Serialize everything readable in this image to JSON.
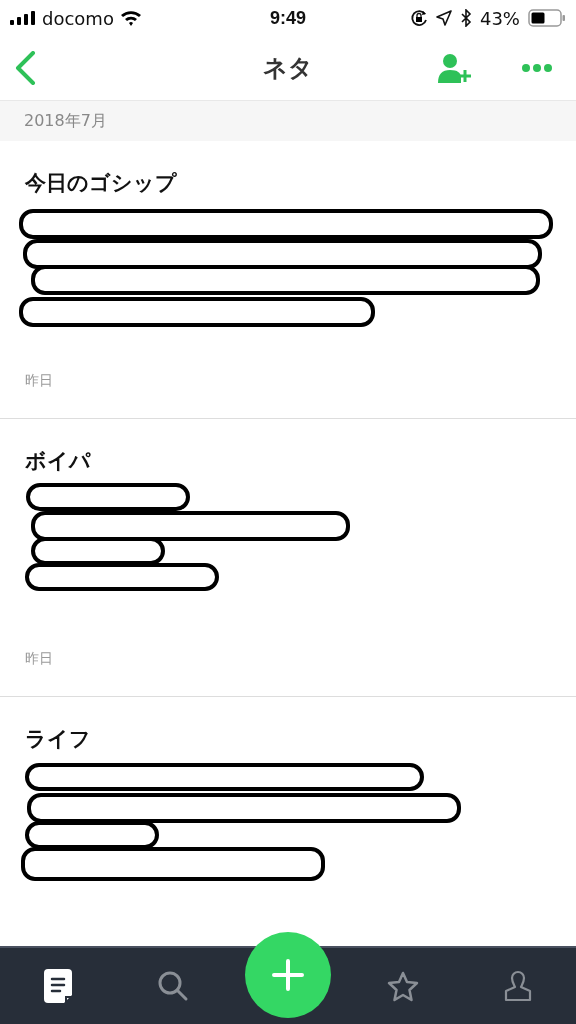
{
  "status_bar": {
    "carrier": "docomo",
    "time": "9:49",
    "battery": "43%"
  },
  "nav": {
    "title": "ネタ"
  },
  "section": {
    "header": "2018年7月"
  },
  "notes": [
    {
      "title": "今日のゴシップ",
      "body": {
        "kind": "redacted"
      },
      "date": "昨日"
    },
    {
      "title": "ボイパ",
      "body": {
        "kind": "redacted"
      },
      "date": "昨日"
    },
    {
      "title": "ライフ",
      "body": {
        "kind": "redacted"
      }
    }
  ],
  "tabs": [
    {
      "kind": "notes",
      "selected": true
    },
    {
      "kind": "search",
      "selected": false
    },
    {
      "kind": "add"
    },
    {
      "kind": "star",
      "selected": false
    },
    {
      "kind": "profile",
      "selected": false
    }
  ]
}
